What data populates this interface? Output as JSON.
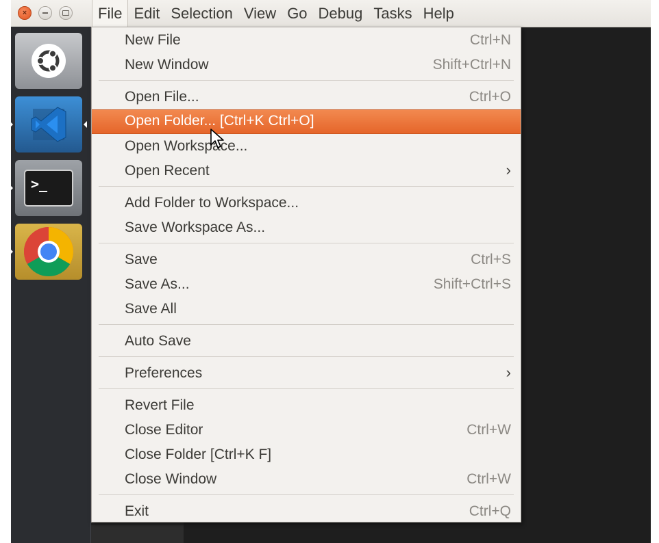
{
  "window_controls": {
    "close_icon": "close-icon",
    "minimize_icon": "minimize-icon",
    "maximize_icon": "maximize-icon"
  },
  "menubar": [
    {
      "label": "File",
      "active": true
    },
    {
      "label": "Edit"
    },
    {
      "label": "Selection"
    },
    {
      "label": "View"
    },
    {
      "label": "Go"
    },
    {
      "label": "Debug"
    },
    {
      "label": "Tasks"
    },
    {
      "label": "Help"
    }
  ],
  "launcher": [
    {
      "name": "ubuntu-dash-icon"
    },
    {
      "name": "vscode-icon",
      "active": true
    },
    {
      "name": "terminal-icon"
    },
    {
      "name": "chrome-icon"
    }
  ],
  "file_menu": {
    "items": [
      {
        "label": "New File",
        "shortcut": "Ctrl+N"
      },
      {
        "label": "New Window",
        "shortcut": "Shift+Ctrl+N"
      },
      {
        "label": "Open File...",
        "shortcut": "Ctrl+O"
      },
      {
        "label": "Open Folder... [Ctrl+K Ctrl+O]",
        "shortcut": "",
        "highlighted": true
      },
      {
        "label": "Open Workspace...",
        "shortcut": ""
      },
      {
        "label": "Open Recent",
        "shortcut": "",
        "submenu": true
      },
      {
        "label": "Add Folder to Workspace...",
        "shortcut": ""
      },
      {
        "label": "Save Workspace As...",
        "shortcut": ""
      },
      {
        "label": "Save",
        "shortcut": "Ctrl+S"
      },
      {
        "label": "Save As...",
        "shortcut": "Shift+Ctrl+S"
      },
      {
        "label": "Save All",
        "shortcut": ""
      },
      {
        "label": "Auto Save",
        "shortcut": ""
      },
      {
        "label": "Preferences",
        "shortcut": "",
        "submenu": true
      },
      {
        "label": "Revert File",
        "shortcut": ""
      },
      {
        "label": "Close Editor",
        "shortcut": "Ctrl+W"
      },
      {
        "label": "Close Folder [Ctrl+K F]",
        "shortcut": ""
      },
      {
        "label": "Close Window",
        "shortcut": "Ctrl+W"
      },
      {
        "label": "Exit",
        "shortcut": "Ctrl+Q"
      }
    ]
  },
  "colors": {
    "highlight": "#e5652a",
    "menu_bg": "#f3f1ee",
    "editor_bg": "#1e1e1e"
  }
}
